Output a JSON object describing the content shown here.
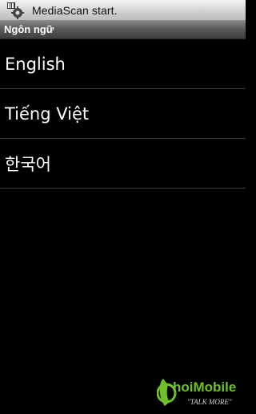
{
  "status_bar": {
    "notification_text": "MediaScan start.",
    "icon": "media-scan-gear-icon"
  },
  "title_bar": {
    "title": "Ngôn ngữ"
  },
  "languages": [
    {
      "label": "English"
    },
    {
      "label": "Tiếng Việt"
    },
    {
      "label": "한국어"
    }
  ],
  "watermark": {
    "brand_text": "hoiMobile",
    "tagline": "\"TALK MORE\"",
    "icon": "phone-handset-icon",
    "colors": {
      "brand": "#6fc02a",
      "tagline": "#d0d0d0"
    }
  }
}
